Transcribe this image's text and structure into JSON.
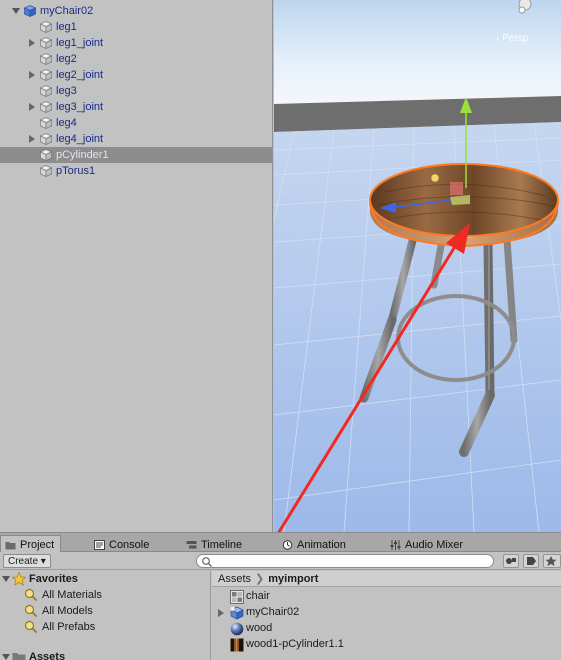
{
  "hierarchy": {
    "items": [
      {
        "label": "myChair02",
        "depth": 0,
        "foldout": "open",
        "icon": "prefab-cube-icon"
      },
      {
        "label": "leg1",
        "depth": 1,
        "foldout": "none",
        "icon": "gameobject-cube-icon"
      },
      {
        "label": "leg1_joint",
        "depth": 1,
        "foldout": "closed",
        "icon": "gameobject-cube-icon"
      },
      {
        "label": "leg2",
        "depth": 1,
        "foldout": "none",
        "icon": "gameobject-cube-icon"
      },
      {
        "label": "leg2_joint",
        "depth": 1,
        "foldout": "closed",
        "icon": "gameobject-cube-icon"
      },
      {
        "label": "leg3",
        "depth": 1,
        "foldout": "none",
        "icon": "gameobject-cube-icon"
      },
      {
        "label": "leg3_joint",
        "depth": 1,
        "foldout": "closed",
        "icon": "gameobject-cube-icon"
      },
      {
        "label": "leg4",
        "depth": 1,
        "foldout": "none",
        "icon": "gameobject-cube-icon"
      },
      {
        "label": "leg4_joint",
        "depth": 1,
        "foldout": "closed",
        "icon": "gameobject-cube-icon"
      },
      {
        "label": "pCylinder1",
        "depth": 1,
        "foldout": "none",
        "icon": "gameobject-cube-icon",
        "selected": true
      },
      {
        "label": "pTorus1",
        "depth": 1,
        "foldout": "none",
        "icon": "gameobject-cube-icon"
      }
    ]
  },
  "scene": {
    "projection_label": "‹ Persp",
    "colors": {
      "sky": "#cfe3f6",
      "horizon": "#6e6e6e",
      "ground": "#a3bee9",
      "wood": "#8a5a35",
      "outline": "#ff7a1e",
      "arrow": "#ef2a22",
      "y_axis": "#98e13a",
      "z_axis": "#3b67e6"
    }
  },
  "tabs": [
    {
      "label": "Project",
      "icon": "folder-icon",
      "active": true
    },
    {
      "label": "Console",
      "icon": "console-icon"
    },
    {
      "label": "Timeline",
      "icon": "timeline-icon"
    },
    {
      "label": "Animation",
      "icon": "animation-clock-icon"
    },
    {
      "label": "Audio Mixer",
      "icon": "audio-mixer-icon"
    }
  ],
  "toolbar": {
    "create_label": "Create ▾",
    "search_value": ""
  },
  "project_left": {
    "favorites_label": "Favorites",
    "items": [
      "All Materials",
      "All Models",
      "All Prefabs"
    ],
    "assets_label": "Assets"
  },
  "project_right": {
    "breadcrumb": [
      "Assets",
      "myimport"
    ],
    "items": [
      {
        "label": "chair",
        "icon": "texture-icon"
      },
      {
        "label": "myChair02",
        "icon": "model-prefab-icon",
        "foldout": true
      },
      {
        "label": "wood",
        "icon": "material-sphere-icon"
      },
      {
        "label": "wood1-pCylinder1.1",
        "icon": "wood-texture-icon"
      }
    ]
  }
}
